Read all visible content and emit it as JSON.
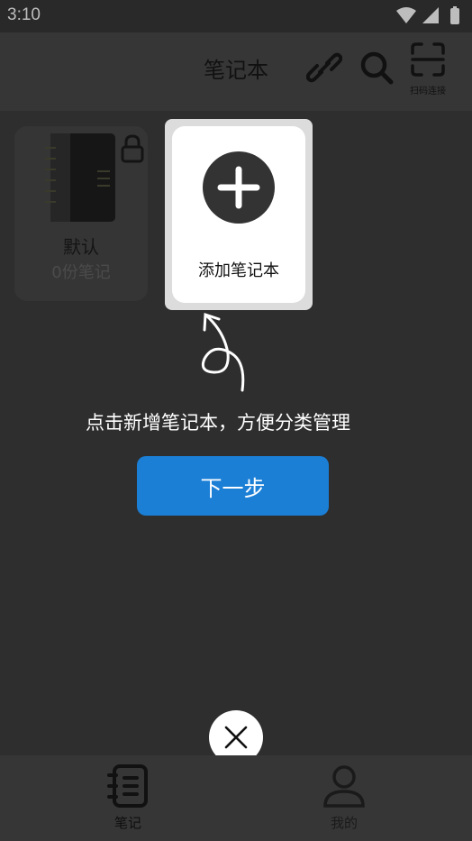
{
  "status_bar": {
    "time": "3:10",
    "icons": [
      "wifi-icon",
      "signal-icon",
      "battery-icon"
    ]
  },
  "header": {
    "title": "笔记本",
    "link_icon": "link-icon",
    "search_icon": "search-icon",
    "scan_label": "扫码连接"
  },
  "notebook": {
    "name": "默认",
    "count": "0份笔记",
    "locked": true
  },
  "add_card": {
    "label": "添加笔记本"
  },
  "guide": {
    "tip": "点击新增笔记本，方便分类管理",
    "next_label": "下一步"
  },
  "bottom_nav": {
    "items": [
      {
        "label": "笔记",
        "icon": "notebook-icon",
        "active": true
      },
      {
        "label": "我的",
        "icon": "person-icon",
        "active": false
      }
    ]
  },
  "colors": {
    "accent": "#1b7fd6",
    "overlay": "#2e2e2e",
    "spotlight": "#ffffff"
  }
}
